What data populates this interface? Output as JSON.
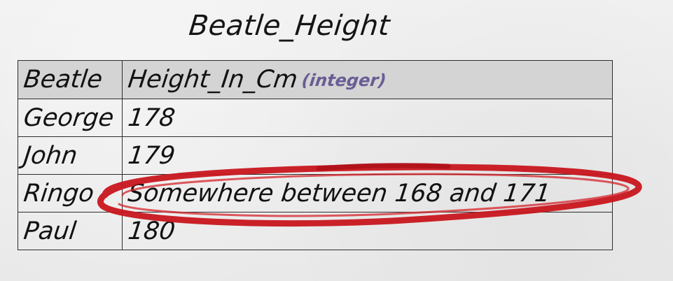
{
  "title": "Beatle_Height",
  "table": {
    "columns": {
      "name": "Beatle",
      "height": "Height_In_Cm",
      "height_type": "(integer)"
    },
    "rows": [
      {
        "name": "George",
        "height": "178"
      },
      {
        "name": "John",
        "height": "179"
      },
      {
        "name": "Ringo",
        "height": "Somewhere between 168 and 171"
      },
      {
        "name": "Paul",
        "height": "180"
      }
    ]
  },
  "annotation": {
    "shape": "red hand-drawn ellipse",
    "target_row": "Ringo",
    "color": "#c8161d"
  },
  "colors": {
    "header_bg": "#d4d4d4",
    "type_hint": "#6a5d95",
    "ink": "#121212"
  }
}
